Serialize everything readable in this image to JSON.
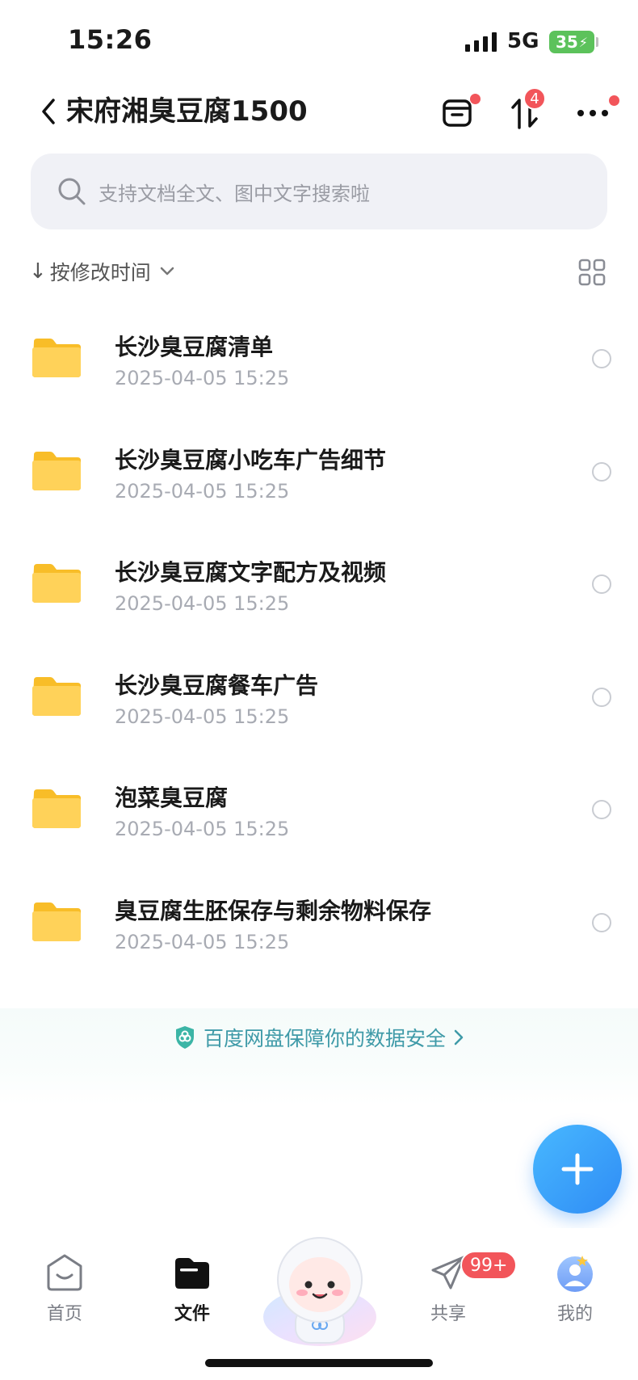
{
  "status_bar": {
    "time": "15:26",
    "network": "5G",
    "battery": "35"
  },
  "header": {
    "title": "宋府湘臭豆腐1500",
    "transfer_badge": "4"
  },
  "search": {
    "placeholder": "支持文档全文、图中文字搜索啦"
  },
  "sort": {
    "arrow": "↓",
    "label": "按修改时间"
  },
  "files": [
    {
      "name": "长沙臭豆腐清单",
      "date": "2025-04-05 15:25"
    },
    {
      "name": "长沙臭豆腐小吃车广告细节",
      "date": "2025-04-05 15:25"
    },
    {
      "name": "长沙臭豆腐文字配方及视频",
      "date": "2025-04-05 15:25"
    },
    {
      "name": "长沙臭豆腐餐车广告",
      "date": "2025-04-05 15:25"
    },
    {
      "name": "泡菜臭豆腐",
      "date": "2025-04-05 15:25"
    },
    {
      "name": "臭豆腐生胚保存与剩余物料保存",
      "date": "2025-04-05 15:25"
    }
  ],
  "safety_banner": {
    "text": "百度网盘保障你的数据安全"
  },
  "tabbar": {
    "home": "首页",
    "files": "文件",
    "share": "共享",
    "share_badge": "99+",
    "mine": "我的"
  },
  "colors": {
    "accent": "#2f8cf5",
    "folder": "#fcc93a",
    "badge": "#f2555a",
    "safety": "#3f9aa8"
  },
  "icons": [
    "back-icon",
    "inbox-icon",
    "transfer-icon",
    "more-icon",
    "search-icon",
    "grid-view-icon",
    "folder-icon",
    "shield-icon",
    "plus-icon",
    "home-icon",
    "files-icon",
    "share-icon",
    "profile-icon"
  ]
}
